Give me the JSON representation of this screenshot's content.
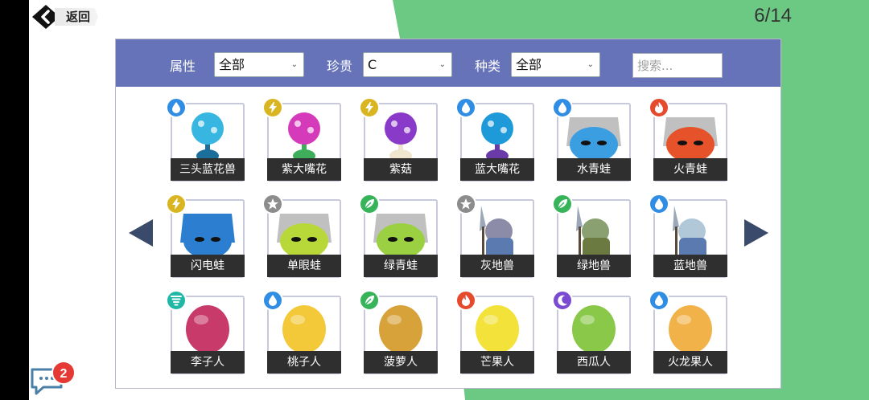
{
  "header": {
    "back_label": "返回",
    "page_counter": "6/14"
  },
  "filters": {
    "attribute": {
      "label": "属性",
      "value": "全部"
    },
    "rarity": {
      "label": "珍贵",
      "value": "C"
    },
    "kind": {
      "label": "种类",
      "value": "全部"
    },
    "search": {
      "placeholder": "搜索..."
    }
  },
  "colors": {
    "water": "#2f8de4",
    "electric": "#d9b521",
    "fire": "#e54a2d",
    "grass": "#37b35a",
    "neutral": "#8c8c8c",
    "wind": "#1fb8a6",
    "moon": "#7a4ad0",
    "filter_bar": "#6673b8",
    "background_green": "#6cc984"
  },
  "creatures": [
    {
      "name": "三头蓝花兽",
      "element": "water",
      "element_icon": "water-drop-icon"
    },
    {
      "name": "紫大嘴花",
      "element": "electric",
      "element_icon": "lightning-icon"
    },
    {
      "name": "紫菇",
      "element": "electric",
      "element_icon": "lightning-icon"
    },
    {
      "name": "蓝大嘴花",
      "element": "water",
      "element_icon": "water-drop-icon"
    },
    {
      "name": "水青蛙",
      "element": "water",
      "element_icon": "water-drop-icon"
    },
    {
      "name": "火青蛙",
      "element": "fire",
      "element_icon": "flame-icon"
    },
    {
      "name": "闪电蛙",
      "element": "electric",
      "element_icon": "lightning-icon"
    },
    {
      "name": "单眼蛙",
      "element": "neutral",
      "element_icon": "star-icon"
    },
    {
      "name": "绿青蛙",
      "element": "grass",
      "element_icon": "leaf-icon"
    },
    {
      "name": "灰地兽",
      "element": "neutral",
      "element_icon": "star-icon"
    },
    {
      "name": "绿地兽",
      "element": "grass",
      "element_icon": "leaf-icon"
    },
    {
      "name": "蓝地兽",
      "element": "water",
      "element_icon": "water-drop-icon"
    },
    {
      "name": "李子人",
      "element": "wind",
      "element_icon": "tornado-icon"
    },
    {
      "name": "桃子人",
      "element": "water",
      "element_icon": "water-drop-icon"
    },
    {
      "name": "菠萝人",
      "element": "grass",
      "element_icon": "leaf-icon"
    },
    {
      "name": "芒果人",
      "element": "fire",
      "element_icon": "flame-icon"
    },
    {
      "name": "西瓜人",
      "element": "moon",
      "element_icon": "moon-icon"
    },
    {
      "name": "火龙果人",
      "element": "water",
      "element_icon": "water-drop-icon"
    }
  ],
  "chat": {
    "unread_count": "2"
  }
}
